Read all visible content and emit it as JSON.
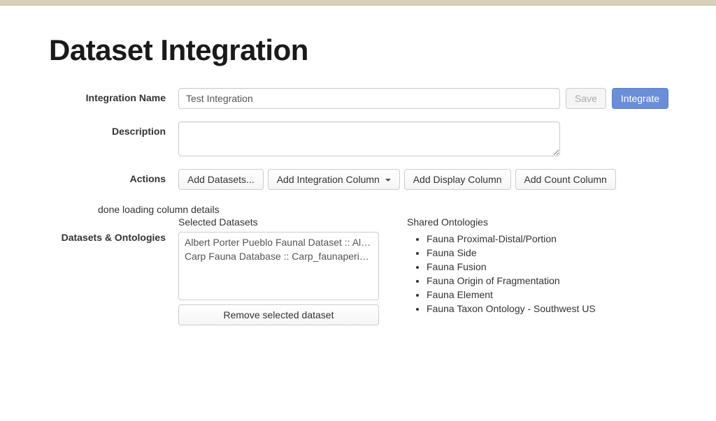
{
  "page": {
    "title": "Dataset Integration"
  },
  "labels": {
    "integration_name": "Integration Name",
    "description": "Description",
    "actions": "Actions",
    "datasets_ontologies": "Datasets & Ontologies",
    "selected_datasets": "Selected Datasets",
    "shared_ontologies": "Shared Ontologies"
  },
  "form": {
    "integration_name_value": "Test Integration",
    "description_value": ""
  },
  "buttons": {
    "save": "Save",
    "integrate": "Integrate",
    "add_datasets": "Add Datasets...",
    "add_integration_column": "Add Integration Column",
    "add_display_column": "Add Display Column",
    "add_count_column": "Add Count Column",
    "remove_selected": "Remove selected dataset"
  },
  "status": {
    "text": "done loading column details"
  },
  "selected_datasets": [
    "Albert Porter Pueblo Faunal Dataset :: Albert-",
    "Carp Fauna Database :: Carp_faunaperiodcor"
  ],
  "shared_ontologies": [
    "Fauna Proximal-Distal/Portion",
    "Fauna Side",
    "Fauna Fusion",
    "Fauna Origin of Fragmentation",
    "Fauna Element",
    "Fauna Taxon Ontology - Southwest US"
  ]
}
